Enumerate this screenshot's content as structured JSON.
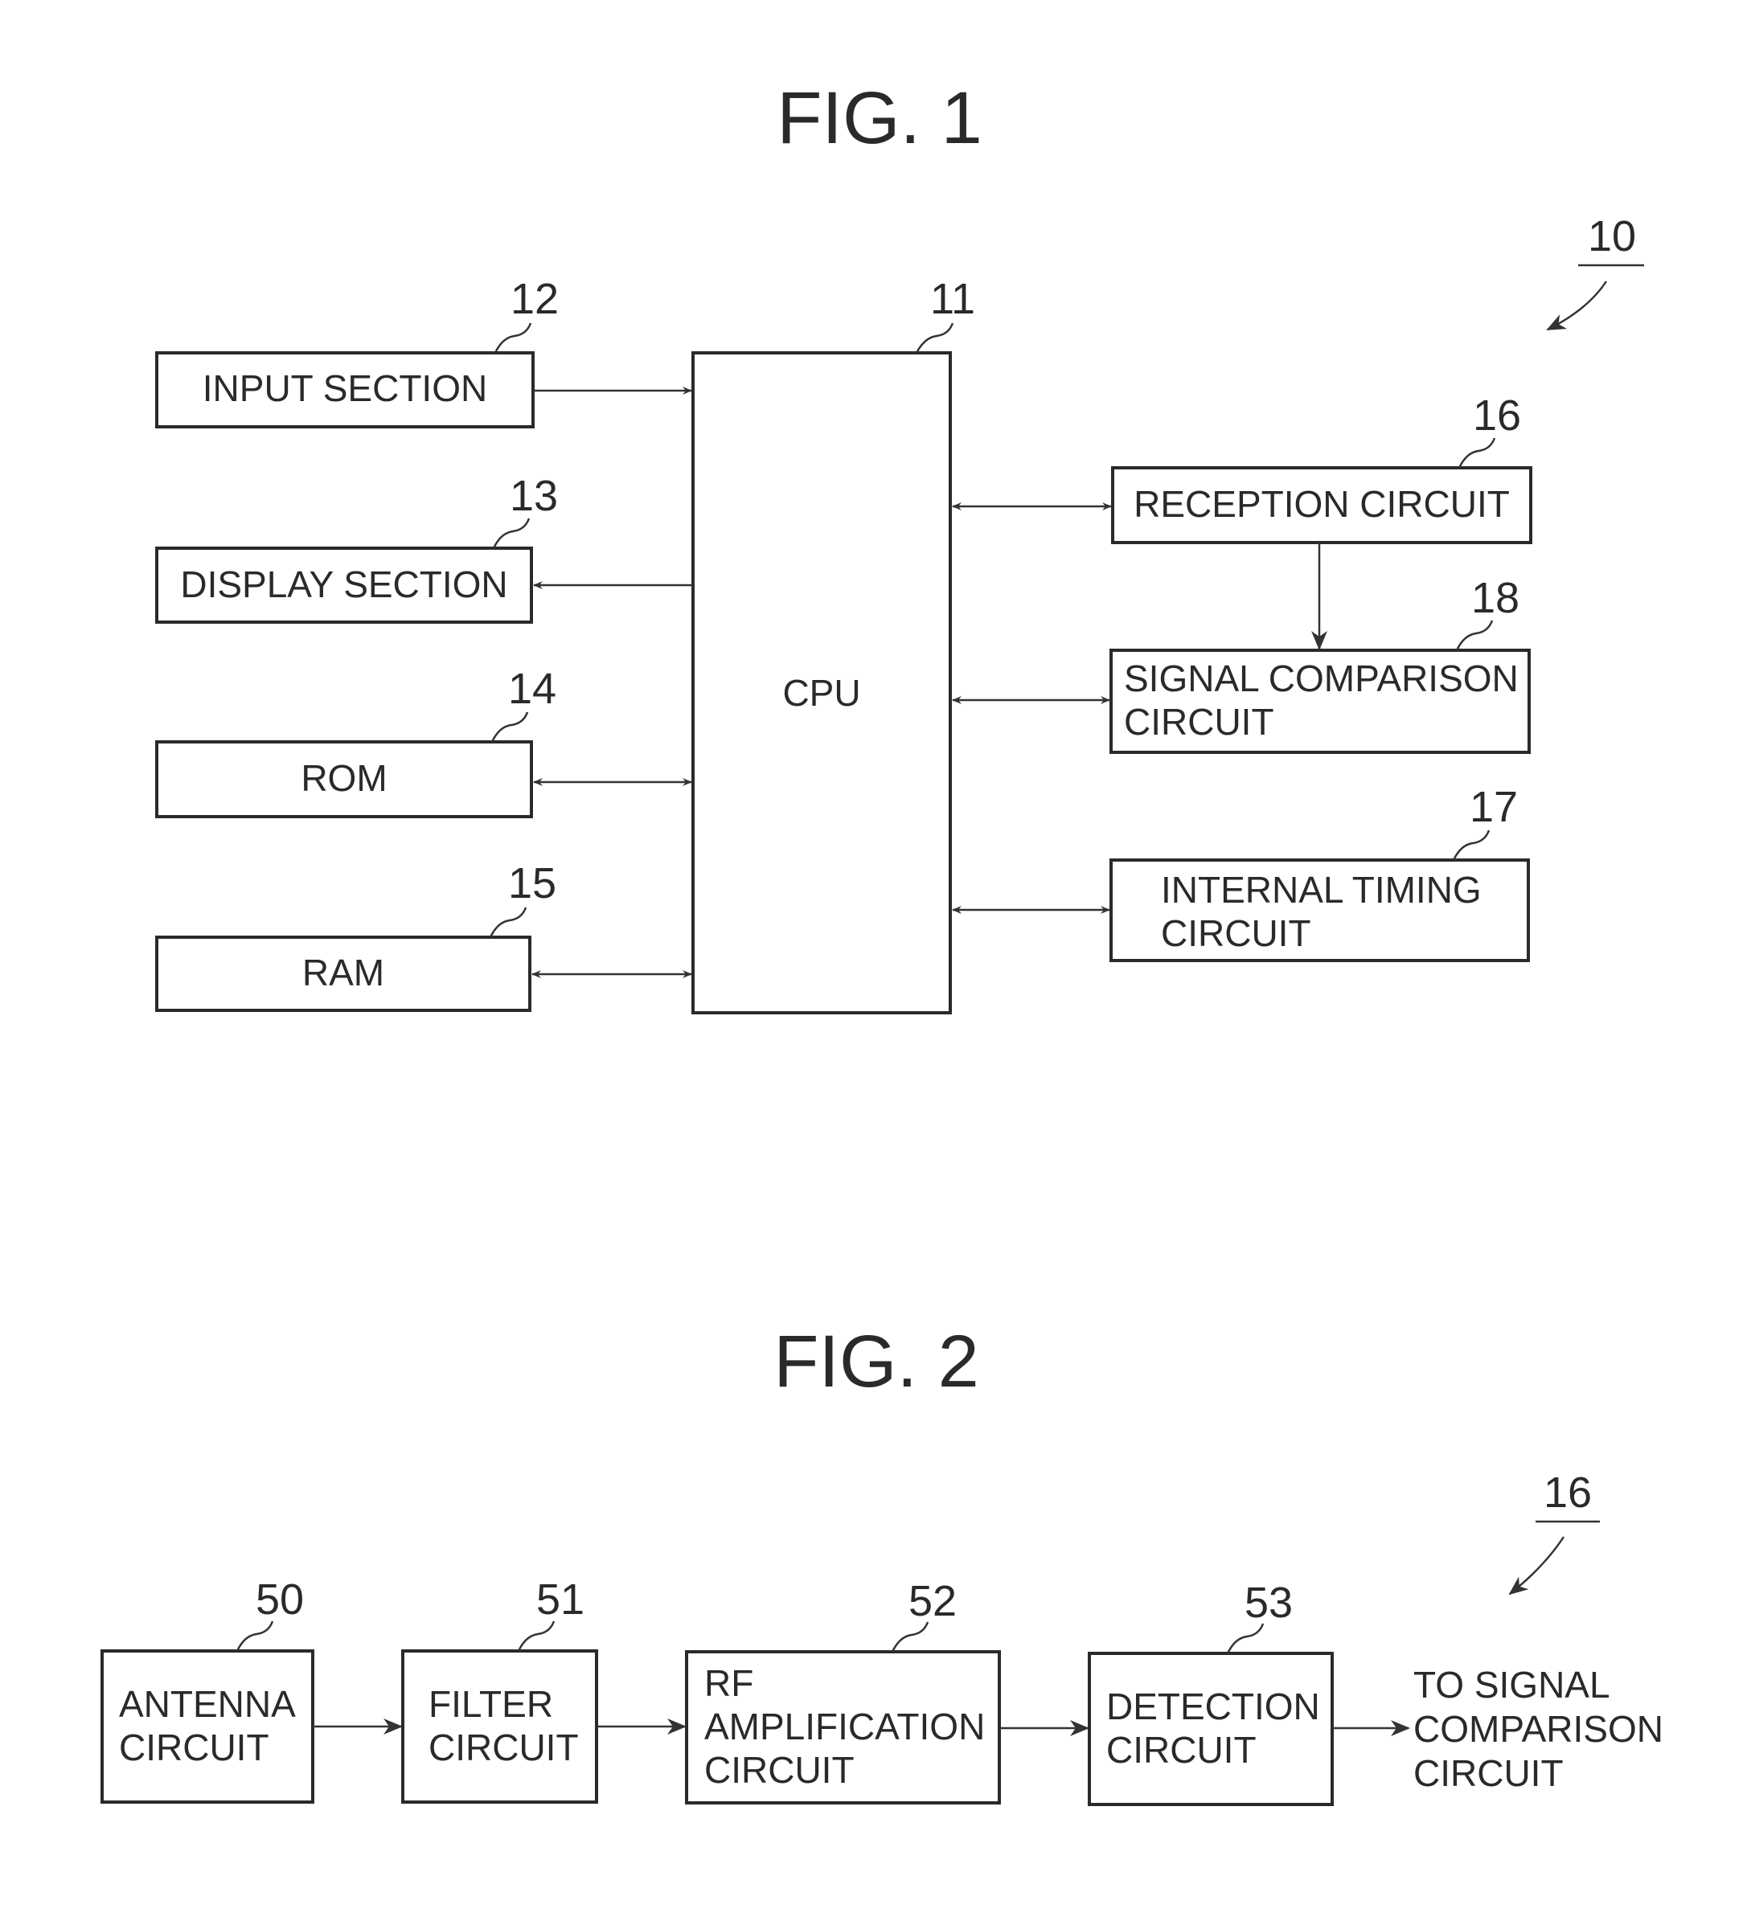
{
  "fig1": {
    "title": "FIG. 1",
    "system_ref": "10",
    "blocks": {
      "cpu": {
        "ref": "11",
        "lines": [
          "CPU"
        ]
      },
      "input": {
        "ref": "12",
        "lines": [
          "INPUT SECTION"
        ]
      },
      "display": {
        "ref": "13",
        "lines": [
          "DISPLAY SECTION"
        ]
      },
      "rom": {
        "ref": "14",
        "lines": [
          "ROM"
        ]
      },
      "ram": {
        "ref": "15",
        "lines": [
          "RAM"
        ]
      },
      "reception": {
        "ref": "16",
        "lines": [
          "RECEPTION CIRCUIT"
        ]
      },
      "timing": {
        "ref": "17",
        "lines": [
          "INTERNAL TIMING",
          "CIRCUIT"
        ]
      },
      "comparison": {
        "ref": "18",
        "lines": [
          "SIGNAL COMPARISON",
          "CIRCUIT"
        ]
      }
    },
    "connections": [
      {
        "from": "input",
        "to": "cpu",
        "direction": "one-way"
      },
      {
        "from": "cpu",
        "to": "display",
        "direction": "one-way"
      },
      {
        "from": "cpu",
        "to": "rom",
        "direction": "two-way"
      },
      {
        "from": "cpu",
        "to": "ram",
        "direction": "two-way"
      },
      {
        "from": "cpu",
        "to": "reception",
        "direction": "two-way"
      },
      {
        "from": "cpu",
        "to": "comparison",
        "direction": "two-way"
      },
      {
        "from": "cpu",
        "to": "timing",
        "direction": "two-way"
      },
      {
        "from": "reception",
        "to": "comparison",
        "direction": "one-way"
      }
    ]
  },
  "fig2": {
    "title": "FIG. 2",
    "system_ref": "16",
    "blocks": {
      "antenna": {
        "ref": "50",
        "lines": [
          "ANTENNA",
          "CIRCUIT"
        ]
      },
      "filter": {
        "ref": "51",
        "lines": [
          "FILTER",
          "CIRCUIT"
        ]
      },
      "rfamp": {
        "ref": "52",
        "lines": [
          "RF",
          "AMPLIFICATION",
          "CIRCUIT"
        ]
      },
      "detection": {
        "ref": "53",
        "lines": [
          "DETECTION",
          "CIRCUIT"
        ]
      }
    },
    "output_label": [
      "TO SIGNAL",
      "COMPARISON",
      "CIRCUIT"
    ],
    "connections": [
      {
        "from": "antenna",
        "to": "filter",
        "direction": "one-way"
      },
      {
        "from": "filter",
        "to": "rfamp",
        "direction": "one-way"
      },
      {
        "from": "rfamp",
        "to": "detection",
        "direction": "one-way"
      },
      {
        "from": "detection",
        "to": "output",
        "direction": "one-way"
      }
    ]
  }
}
